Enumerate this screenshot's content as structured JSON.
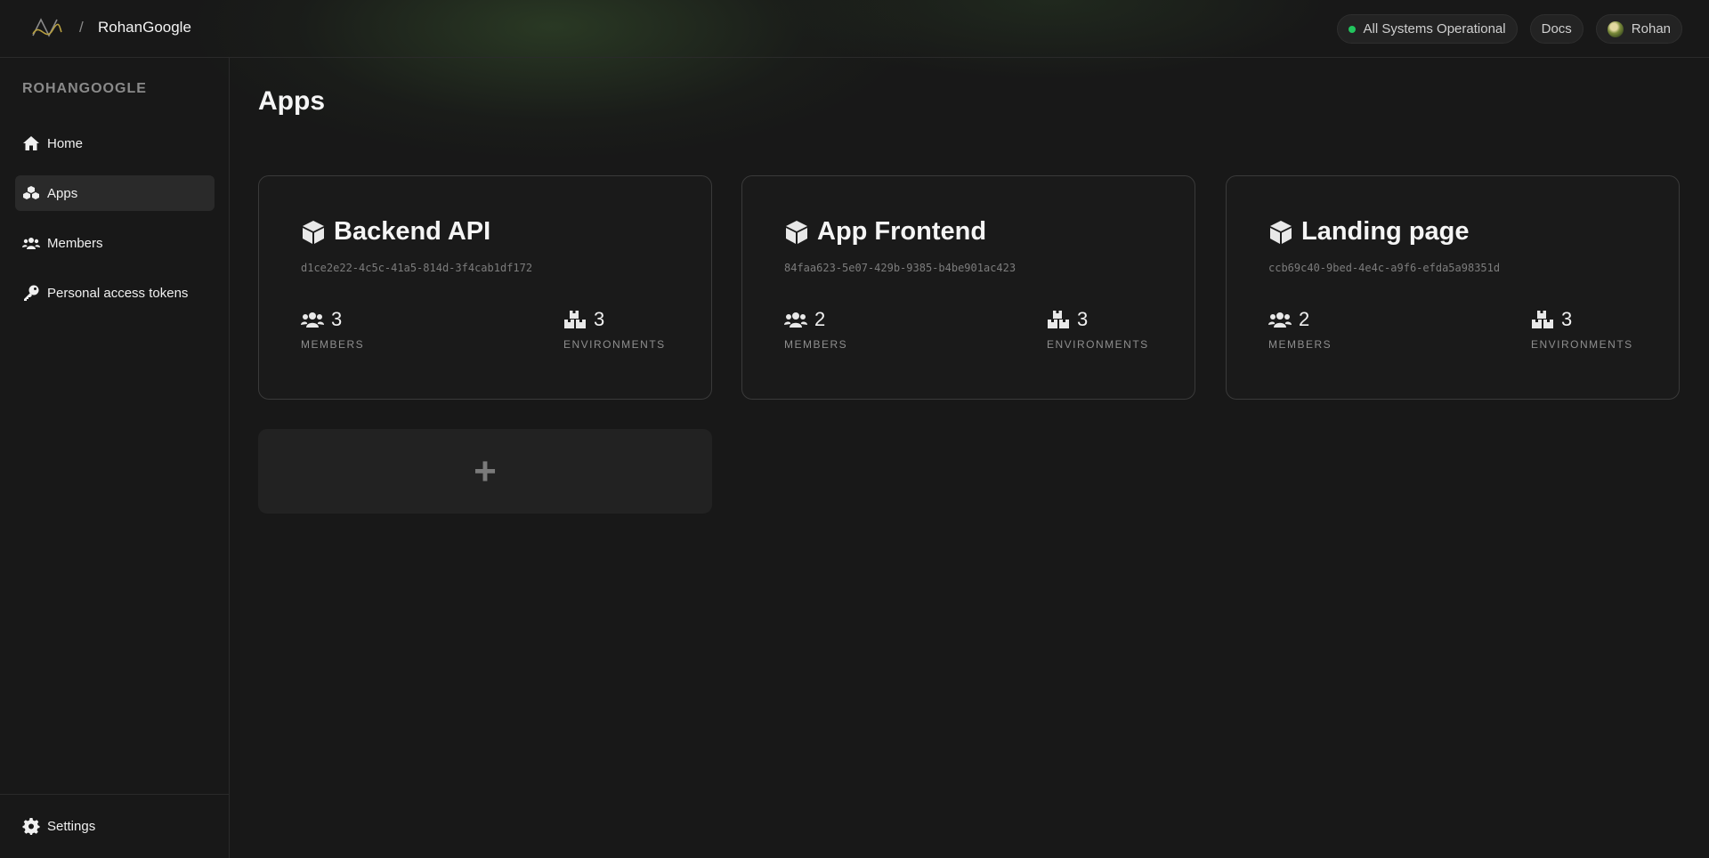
{
  "header": {
    "breadcrumb_sep": "/",
    "org_name": "RohanGoogle",
    "status_label": "All Systems Operational",
    "status_color": "#22c55e",
    "docs_label": "Docs",
    "user_name": "Rohan"
  },
  "sidebar": {
    "heading": "ROHANGOOGLE",
    "items": [
      {
        "label": "Home",
        "icon": "home-icon"
      },
      {
        "label": "Apps",
        "icon": "apps-icon",
        "active": true
      },
      {
        "label": "Members",
        "icon": "members-icon"
      },
      {
        "label": "Personal access tokens",
        "icon": "key-icon"
      }
    ],
    "settings_label": "Settings"
  },
  "main": {
    "title": "Apps",
    "apps": [
      {
        "name": "Backend API",
        "id": "d1ce2e22-4c5c-41a5-814d-3f4cab1df172",
        "members": "3",
        "environments": "3"
      },
      {
        "name": "App Frontend",
        "id": "84faa623-5e07-429b-9385-b4be901ac423",
        "members": "2",
        "environments": "3"
      },
      {
        "name": "Landing page",
        "id": "ccb69c40-9bed-4e4c-a9f6-efda5a98351d",
        "members": "2",
        "environments": "3"
      }
    ],
    "members_label": "MEMBERS",
    "environments_label": "ENVIRONMENTS",
    "add_label": "+"
  }
}
